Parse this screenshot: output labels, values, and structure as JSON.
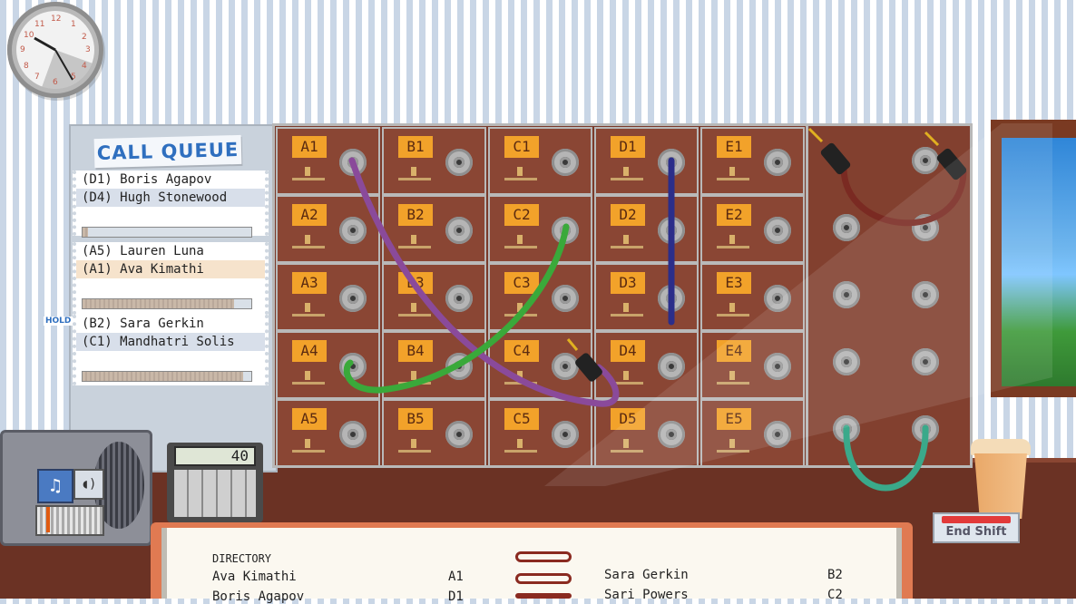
{
  "queue": {
    "title": "CALL QUEUE",
    "groups": [
      {
        "lines": [
          "(D1) Boris Agapov",
          "(D4) Hugh Stonewood"
        ],
        "progress": 0.03
      },
      {
        "lines": [
          "(A5) Lauren Luna",
          "(A1) Ava Kimathi"
        ],
        "progress": 0.9
      },
      {
        "lines": [
          "(B2) Sara Gerkin",
          "(C1) Mandhatri Solis"
        ],
        "progress": 0.95,
        "tag": "HOLD"
      }
    ]
  },
  "board": {
    "labels": [
      [
        "A1",
        "B1",
        "C1",
        "D1",
        "E1"
      ],
      [
        "A2",
        "B2",
        "C2",
        "D2",
        "E2"
      ],
      [
        "A3",
        "B3",
        "C3",
        "D3",
        "E3"
      ],
      [
        "A4",
        "B4",
        "C4",
        "D4",
        "E4"
      ],
      [
        "A5",
        "B5",
        "C5",
        "D5",
        "E5"
      ]
    ],
    "cable_colors": {
      "purple": "#8a4a9a",
      "green": "#3aa93a",
      "navy": "#2b2e8a",
      "maroon": "#7a2a22",
      "teal": "#3aa98a"
    }
  },
  "calculator": {
    "display": "40"
  },
  "end_shift": {
    "label": "End Shift"
  },
  "directory": {
    "title": "DIRECTORY",
    "left": [
      {
        "name": "Ava Kimathi",
        "code": "A1"
      },
      {
        "name": "Boris Agapov",
        "code": "D1"
      }
    ],
    "right": [
      {
        "name": "Sara Gerkin",
        "code": "B2"
      },
      {
        "name": "Sari Powers",
        "code": "C2"
      }
    ]
  },
  "clock": {
    "numerals": [
      "12",
      "1",
      "2",
      "3",
      "4",
      "5",
      "6",
      "7",
      "8",
      "9",
      "10",
      "11"
    ]
  }
}
